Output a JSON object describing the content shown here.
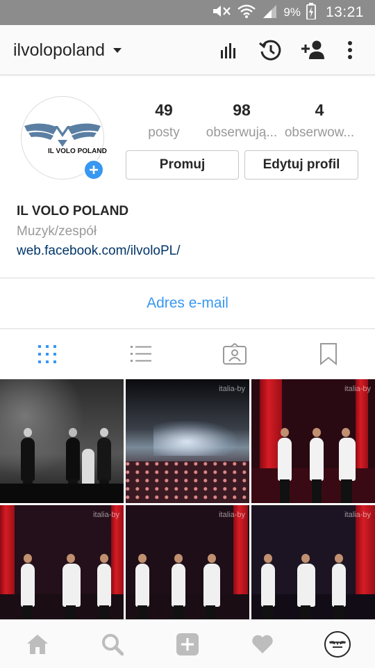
{
  "status_bar": {
    "battery_percent": "9%",
    "time": "13:21",
    "icons": [
      "mute-icon",
      "wifi-icon",
      "signal-icon",
      "battery-charging-icon"
    ]
  },
  "header": {
    "username": "ilvolopoland",
    "actions": [
      "insights-icon",
      "archive-history-icon",
      "add-person-icon",
      "more-options-icon"
    ]
  },
  "profile": {
    "logo_text": "IL VOLO POLAND",
    "stats": [
      {
        "value": "49",
        "label": "posty"
      },
      {
        "value": "98",
        "label": "obserwują..."
      },
      {
        "value": "4",
        "label": "obserwow..."
      }
    ],
    "promote_label": "Promuj",
    "edit_label": "Edytuj profil",
    "name": "IL VOLO POLAND",
    "category": "Muzyk/zespół",
    "website": "web.facebook.com/ilvoloPL/"
  },
  "contact": {
    "email_label": "Adres e-mail"
  },
  "tabs": [
    {
      "name": "grid-view-icon",
      "active": true
    },
    {
      "name": "list-view-icon",
      "active": false
    },
    {
      "name": "tagged-photos-icon",
      "active": false
    },
    {
      "name": "saved-bookmark-icon",
      "active": false
    }
  ],
  "photos": {
    "watermark": "italia-by"
  },
  "bottom_nav": [
    "home-icon",
    "search-icon",
    "add-post-icon",
    "activity-heart-icon",
    "profile-avatar-icon"
  ],
  "colors": {
    "accent_blue": "#3897f0",
    "link_blue": "#003569",
    "status_bar": "#8c8c8c",
    "muted_text": "#999999"
  }
}
